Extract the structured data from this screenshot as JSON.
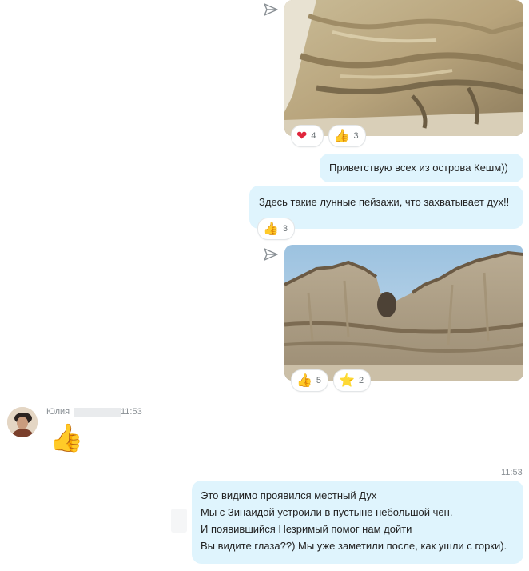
{
  "messages": [
    {
      "type": "photo",
      "description": "sandstone-cliff-close",
      "reactions": [
        {
          "icon": "heart-icon",
          "emoji": "❤",
          "count": "4"
        },
        {
          "icon": "thumbs-up-icon",
          "emoji": "👍",
          "count": "3"
        }
      ]
    },
    {
      "type": "text",
      "text": "Приветствую всех из острова Кешм))"
    },
    {
      "type": "text",
      "text": "Здесь такие лунные пейзажи, что захватывает дух!!",
      "reactions": [
        {
          "icon": "thumbs-up-icon",
          "emoji": "👍",
          "count": "3"
        }
      ]
    },
    {
      "type": "photo",
      "description": "rock-formations-sky",
      "reactions": [
        {
          "icon": "thumbs-up-icon",
          "emoji": "👍",
          "count": "5"
        },
        {
          "icon": "star-icon",
          "emoji": "⭐",
          "count": "2"
        }
      ]
    }
  ],
  "incoming": {
    "sender": "Юлия",
    "time": "11:53",
    "sticker": "👍"
  },
  "outgoing_last": {
    "time": "11:53",
    "lines": [
      "Это видимо проявился местный Дух",
      "Мы с Зинаидой устроили в пустыне небольшой чен.",
      "И появившийся Незримый помог нам дойти",
      "Вы видите глаза??) Мы уже заметили после, как ушли с горки)."
    ]
  },
  "colors": {
    "bubble": "#dff4fd",
    "send_icon": "#8a9095"
  }
}
